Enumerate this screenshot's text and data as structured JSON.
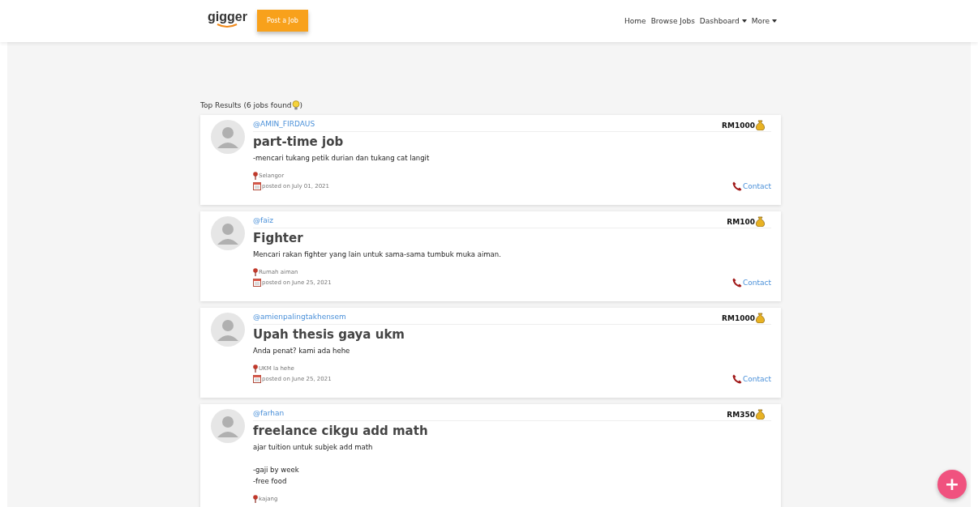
{
  "navbar": {
    "logo": "gigger",
    "post_button": "Post a Job",
    "links": [
      {
        "label": "Home",
        "dropdown": false
      },
      {
        "label": "Browse Jobs",
        "dropdown": false
      },
      {
        "label": "Dashboard",
        "dropdown": true
      },
      {
        "label": "More",
        "dropdown": true
      }
    ]
  },
  "results_heading": {
    "text": "Top Results (6 jobs found",
    "close": ")"
  },
  "jobs": [
    {
      "username": "@AMIN_FIRDAUS",
      "price": "RM1000",
      "title": "part-time job",
      "description": "-mencari tukang petik durian dan tukang cat langit",
      "location": "Selangor",
      "posted": "posted on July 01, 2021",
      "contact": "Contact"
    },
    {
      "username": "@faiz",
      "price": "RM100",
      "title": "Fighter",
      "description": "Mencari rakan fighter yang lain untuk sama-sama tumbuk muka aiman.",
      "location": "Rumah aiman",
      "posted": "posted on June 25, 2021",
      "contact": "Contact"
    },
    {
      "username": "@amienpalingtakhensem",
      "price": "RM1000",
      "title": "Upah thesis gaya ukm",
      "description": "Anda penat? kami ada hehe",
      "location": "UKM la hehe",
      "posted": "posted on June 25, 2021",
      "contact": "Contact"
    },
    {
      "username": "@farhan",
      "price": "RM350",
      "title": "freelance cikgu add math",
      "description": "ajar tuition untuk subjek add math\n\n-gaji by week\n-free food",
      "location": "kajang"
    }
  ],
  "fab": "+"
}
